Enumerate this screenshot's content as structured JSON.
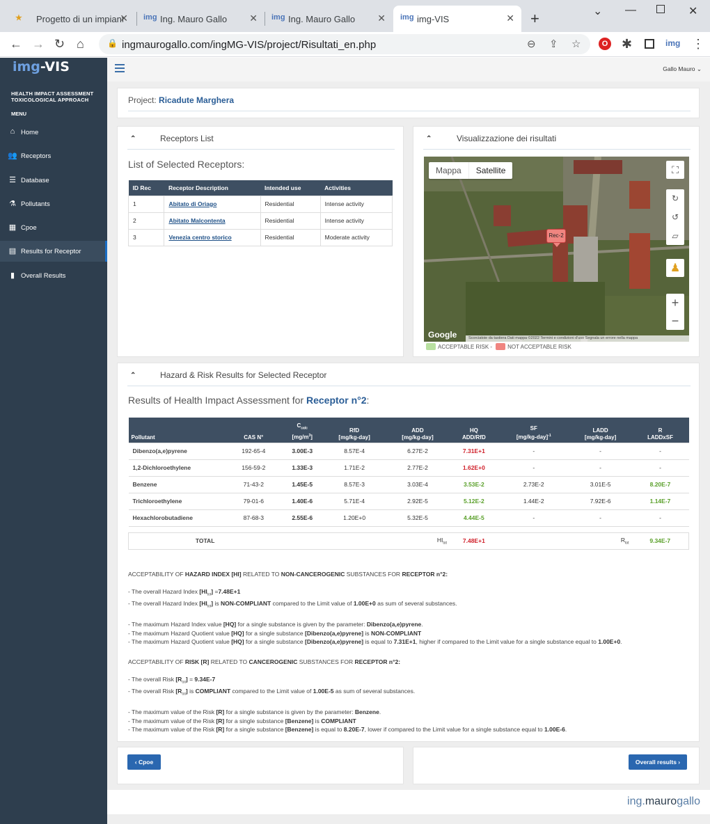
{
  "browser": {
    "tabs": [
      {
        "title": "Progetto di un impianto"
      },
      {
        "title": "Ing. Mauro Gallo"
      },
      {
        "title": "Ing. Mauro Gallo"
      },
      {
        "title": "img-VIS"
      }
    ],
    "url": "ingmaurogallo.com/ingMG-VIS/project/Risultati_en.php",
    "ext_label": "img"
  },
  "sidebar": {
    "logo_a": "img",
    "logo_b": "-VIS",
    "subtitle1": "HEALTH IMPACT ASSESSMENT",
    "subtitle2": "TOXICOLOGICAL APPROACH",
    "menu_label": "MENU",
    "items": [
      {
        "label": "Home",
        "icon": "home-icon"
      },
      {
        "label": "Receptors",
        "icon": "users-icon"
      },
      {
        "label": "Database",
        "icon": "database-icon"
      },
      {
        "label": "Pollutants",
        "icon": "flask-icon"
      },
      {
        "label": "Cpoe",
        "icon": "grid-icon"
      },
      {
        "label": "Results for Receptor",
        "icon": "calculator-icon"
      },
      {
        "label": "Overall Results",
        "icon": "map-icon"
      }
    ]
  },
  "header": {
    "user": "Gallo Mauro"
  },
  "project": {
    "label": "Project:",
    "name": "Ricadute Marghera"
  },
  "receptors": {
    "panel_title": "Receptors List",
    "heading": "List of Selected Receptors:",
    "columns": [
      "ID Rec",
      "Receptor Description",
      "Intended use",
      "Activities"
    ],
    "rows": [
      {
        "id": "1",
        "desc": "Abitato di Oriago",
        "use": "Residential",
        "act": "Intense activity"
      },
      {
        "id": "2",
        "desc": "Abitato Malcontenta",
        "use": "Residential",
        "act": "Intense activity"
      },
      {
        "id": "3",
        "desc": "Venezia centro storico",
        "use": "Residential",
        "act": "Moderate activity"
      }
    ]
  },
  "map": {
    "panel_title": "Visualizzazione dei risultati",
    "type_map": "Mappa",
    "type_sat": "Satellite",
    "marker": "Rec-2",
    "google": "Google",
    "footer": "Scorciatoie da tastiera   Dati mappa ©2022   Termini e condizioni d'uso   Segnala un errore nella mappa",
    "legend_ok": "ACCEPTABLE RISK -",
    "legend_ko": "NOT ACCEPTABLE RISK"
  },
  "results": {
    "panel_title": "Hazard & Risk Results for Selected Receptor",
    "heading_pre": "Results of Health Impact Assessment for",
    "heading_rec": "Receptor n°2",
    "heading_post": ":",
    "cols": {
      "pollutant": "Pollutant",
      "cas": "CAS N°",
      "ccalc": "C",
      "ccalc_sub": "calc",
      "ccalc_unit": "[mg/m",
      "ccalc_unit_sup": "3",
      "ccalc_unit_end": "]",
      "rfd": "RfD",
      "rfd_unit": "[mg/kg-day]",
      "add": "ADD",
      "add_unit": "[mg/kg-day]",
      "hq": "HQ",
      "hq_unit": "ADD/RfD",
      "sf": "SF",
      "sf_unit": "[mg/kg-day]",
      "sf_sup": "-1",
      "ladd": "LADD",
      "ladd_unit": "[mg/kg-day]",
      "r": "R",
      "r_unit": "LADDxSF"
    },
    "rows": [
      {
        "name": "Dibenzo(a,e)pyrene",
        "cas": "192-65-4",
        "c": "3.00E-3",
        "rfd": "8.57E-4",
        "add": "6.27E-2",
        "hq": "7.31E+1",
        "sf": "-",
        "ladd": "-",
        "r": "-"
      },
      {
        "name": "1,2-Dichloroethylene",
        "cas": "156-59-2",
        "c": "1.33E-3",
        "rfd": "1.71E-2",
        "add": "2.77E-2",
        "hq": "1.62E+0",
        "sf": "-",
        "ladd": "-",
        "r": "-"
      },
      {
        "name": "Benzene",
        "cas": "71-43-2",
        "c": "1.45E-5",
        "rfd": "8.57E-3",
        "add": "3.03E-4",
        "hq": "3.53E-2",
        "sf": "2.73E-2",
        "ladd": "3.01E-5",
        "r": "8.20E-7"
      },
      {
        "name": "Trichloroethylene",
        "cas": "79-01-6",
        "c": "1.40E-6",
        "rfd": "5.71E-4",
        "add": "2.92E-5",
        "hq": "5.12E-2",
        "sf": "1.44E-2",
        "ladd": "7.92E-6",
        "r": "1.14E-7"
      },
      {
        "name": "Hexachlorobutadiene",
        "cas": "87-68-3",
        "c": "2.55E-6",
        "rfd": "1.20E+0",
        "add": "5.32E-5",
        "hq": "4.44E-5",
        "sf": "-",
        "ladd": "-",
        "r": "-"
      }
    ],
    "total_label": "TOTAL",
    "hi_label": "HI",
    "hi_sub": "tot",
    "hi_value": "7.48E+1",
    "r_label": "R",
    "r_sub": "tot",
    "r_value": "9.34E-7"
  },
  "text": {
    "hi_heading_a": "ACCEPTABILITY OF ",
    "hi_heading_b": "HAZARD INDEX [HI]",
    "hi_heading_c": " RELATED TO ",
    "hi_heading_d": "NON-CANCEROGENIC",
    "hi_heading_e": " SUBSTANCES FOR ",
    "hi_heading_f": "RECEPTOR n°2:",
    "hi1_a": "- The overall Hazard Index ",
    "hi1_b": "[HI",
    "hi1_sub": "tot",
    "hi1_c": "]",
    "hi1_d": " =",
    "hi1_val": "7.48E+1",
    "hi2_a": "- The overall Hazard Index ",
    "hi2_b": "[HI",
    "hi2_sub": "tot",
    "hi2_c": "]",
    "hi2_d": " is ",
    "hi2_status": "NON-COMPLIANT",
    "hi2_e": " compared to the Limit value of ",
    "hi2_lim": "1.00E+0",
    "hi2_f": " as sum of several substances.",
    "hi3_a": "- The maximum Hazard Index value ",
    "hi3_b": "[HQ]",
    "hi3_c": " for a single substance is given by the parameter: ",
    "hi3_d": "Dibenzo(a,e)pyrene",
    "hi3_e": ".",
    "hi4_a": "- The maximum Hazard Quotient value ",
    "hi4_b": "[HQ]",
    "hi4_c": " for a single substance ",
    "hi4_d": "[Dibenzo(a,e)pyrene]",
    "hi4_e": " is ",
    "hi4_status": "NON-COMPLIANT",
    "hi5_a": "- The maximum Hazard Quotient value ",
    "hi5_b": "[HQ]",
    "hi5_c": " for a single substance ",
    "hi5_d": "[Dibenzo(a,e)pyrene]",
    "hi5_e": " is equal to ",
    "hi5_val": "7.31E+1",
    "hi5_f": ", higher if compared to the Limit value for a single substance equal to ",
    "hi5_lim": "1.00E+0",
    "hi5_g": ".",
    "r_heading_a": "ACCEPTABILITY OF ",
    "r_heading_b": "RISK [R]",
    "r_heading_c": " RELATED TO ",
    "r_heading_d": "CANCEROGENIC",
    "r_heading_e": " SUBSTANCES FOR ",
    "r_heading_f": "RECEPTOR n°2:",
    "r1_a": "- The overall Risk ",
    "r1_b": "[R",
    "r1_sub": "tot",
    "r1_c": "]",
    "r1_d": " = ",
    "r1_val": "9.34E-7",
    "r2_a": "- The overall Risk ",
    "r2_b": "[R",
    "r2_sub": "tot",
    "r2_c": "]",
    "r2_d": " is ",
    "r2_status": "COMPLIANT",
    "r2_e": " compared to the Limit value of ",
    "r2_lim": "1.00E-5",
    "r2_f": " as sum of several substances.",
    "r3_a": "- The maximum value of the Risk ",
    "r3_b": "[R]",
    "r3_c": " for a single substance is given by the parameter: ",
    "r3_d": "Benzene",
    "r3_e": ".",
    "r4_a": "- The maximum value of the Risk ",
    "r4_b": "[R]",
    "r4_c": " for a single substance ",
    "r4_d": "[Benzene]",
    "r4_e": " is ",
    "r4_status": "COMPLIANT",
    "r5_a": "- The maximum value of the Risk ",
    "r5_b": "[R]",
    "r5_c": " for a single substance ",
    "r5_d": "[Benzene]",
    "r5_e": " is equal to ",
    "r5_val": "8.20E-7",
    "r5_f": ", lower if compared to the Limit value for a single substance equal to ",
    "r5_lim": "1.00E-6",
    "r5_g": "."
  },
  "nav": {
    "prev": "‹ Cpoe",
    "next": "Overall results ›"
  },
  "footer": {
    "brand_a": "ing.",
    "brand_b": "mauro",
    "brand_c": "gallo"
  },
  "colors": {
    "sidebar": "#2e3e4e",
    "accent": "#2a67b0",
    "red": "#d0202a",
    "green": "#5aa02a"
  }
}
